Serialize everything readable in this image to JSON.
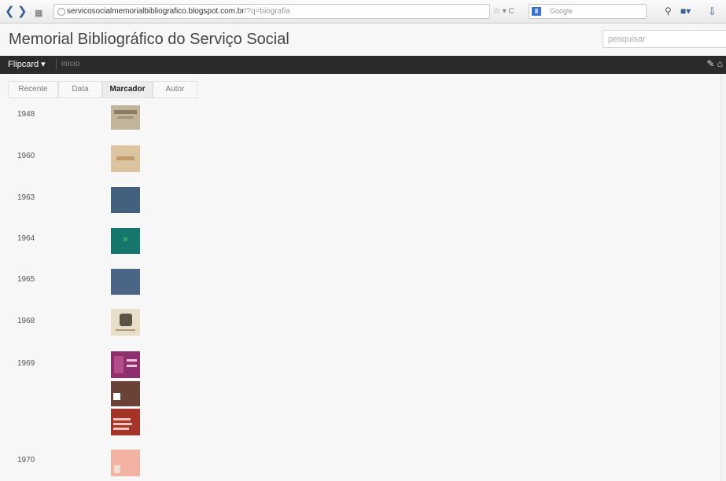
{
  "browser": {
    "url_main": "servicosocialmemorialbibliografico.blogspot.com.br",
    "url_rest": "/?q=biografia",
    "search_engine": "Google"
  },
  "blog": {
    "title": "Memorial Bibliográfico do Serviço Social",
    "search_placeholder": "pesquisar"
  },
  "nav": {
    "view_label": "Flipcard ▾",
    "home_link": "início"
  },
  "tabs": [
    {
      "label": "Recente",
      "active": false
    },
    {
      "label": "Data",
      "active": false
    },
    {
      "label": "Marcador",
      "active": true
    },
    {
      "label": "Autor",
      "active": false
    }
  ],
  "timeline": [
    {
      "year": "1948"
    },
    {
      "year": "1960"
    },
    {
      "year": "1963"
    },
    {
      "year": "1964"
    },
    {
      "year": "1965"
    },
    {
      "year": "1968"
    },
    {
      "year": "1969"
    },
    {
      "year": "1970"
    }
  ],
  "colors": {
    "navbar": "#2b2b2b",
    "page_bg": "#f7f7f7"
  }
}
